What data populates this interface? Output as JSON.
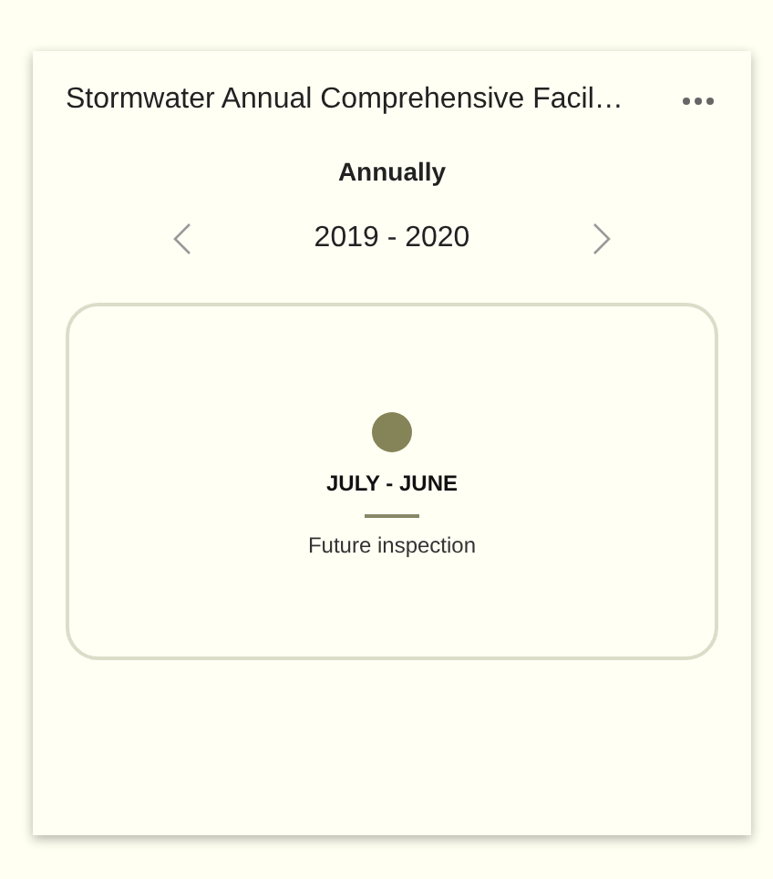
{
  "card": {
    "title": "Stormwater Annual Comprehensive Facil…",
    "frequency": "Annually",
    "period": "2019 - 2020",
    "inspection": {
      "months": "JULY - JUNE",
      "status": "Future inspection",
      "color": "#858358"
    }
  }
}
